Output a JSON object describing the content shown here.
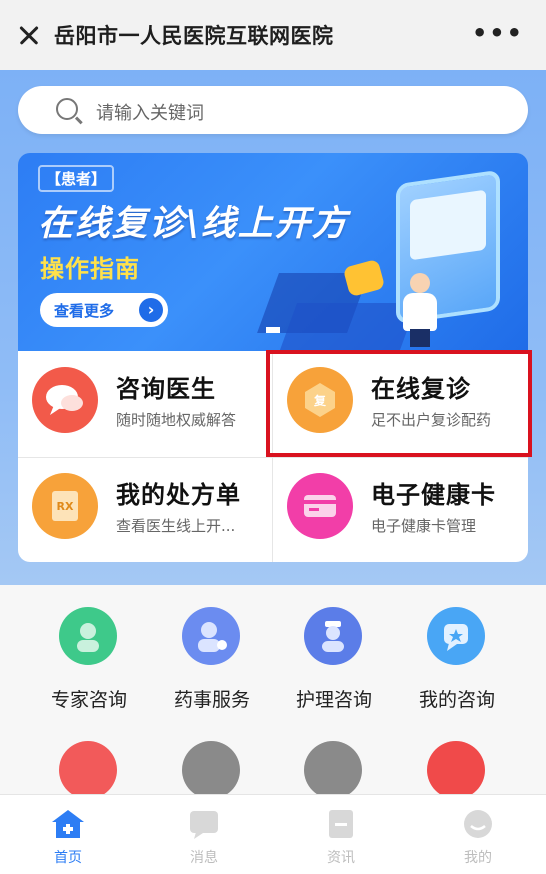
{
  "header": {
    "title": "岳阳市一人民医院互联网医院",
    "more": "•••"
  },
  "search": {
    "placeholder": "请输入关键词"
  },
  "banner": {
    "tag": "【患者】",
    "title": "在线复诊\\线上开方",
    "subtitle": "操作指南",
    "button_label": "查看更多",
    "button_arrow": "›"
  },
  "services": [
    {
      "title": "咨询医生",
      "desc": "随时随地权威解答",
      "icon": "chat-bubbles-icon",
      "color": "#f25a4a"
    },
    {
      "title": "在线复诊",
      "desc": "足不出户复诊配药",
      "icon": "revisit-icon",
      "color": "#f7a23a",
      "glyph": "复"
    },
    {
      "title": "我的处方单",
      "desc": "查看医生线上开...",
      "icon": "prescription-icon",
      "color": "#f7a23a",
      "glyph": "RX"
    },
    {
      "title": "电子健康卡",
      "desc": "电子健康卡管理",
      "icon": "health-card-icon",
      "color": "#f23ea8"
    }
  ],
  "quick_actions": [
    {
      "label": "专家咨询",
      "icon": "expert-consult-icon",
      "color": "#3ec98a"
    },
    {
      "label": "药事服务",
      "icon": "pharmacy-service-icon",
      "color": "#6b8cf0"
    },
    {
      "label": "护理咨询",
      "icon": "nursing-consult-icon",
      "color": "#5b7de8"
    },
    {
      "label": "我的咨询",
      "icon": "my-consult-icon",
      "color": "#49a6f5"
    }
  ],
  "quick_actions_row2": [
    {
      "icon": "red-service-icon",
      "color": "#f25a5a"
    },
    {
      "icon": "doctor-icon",
      "color": "#8a8a8a"
    },
    {
      "icon": "monitor-icon",
      "color": "#8a8a8a"
    },
    {
      "icon": "red-flower-icon",
      "color": "#f04a4a"
    }
  ],
  "tabs": [
    {
      "label": "首页",
      "icon": "home-icon",
      "active": true
    },
    {
      "label": "消息",
      "icon": "message-icon",
      "active": false
    },
    {
      "label": "资讯",
      "icon": "news-icon",
      "active": false
    },
    {
      "label": "我的",
      "icon": "profile-icon",
      "active": false
    }
  ],
  "colors": {
    "accent_blue": "#2d7df4",
    "highlight_red": "#d9121f"
  }
}
